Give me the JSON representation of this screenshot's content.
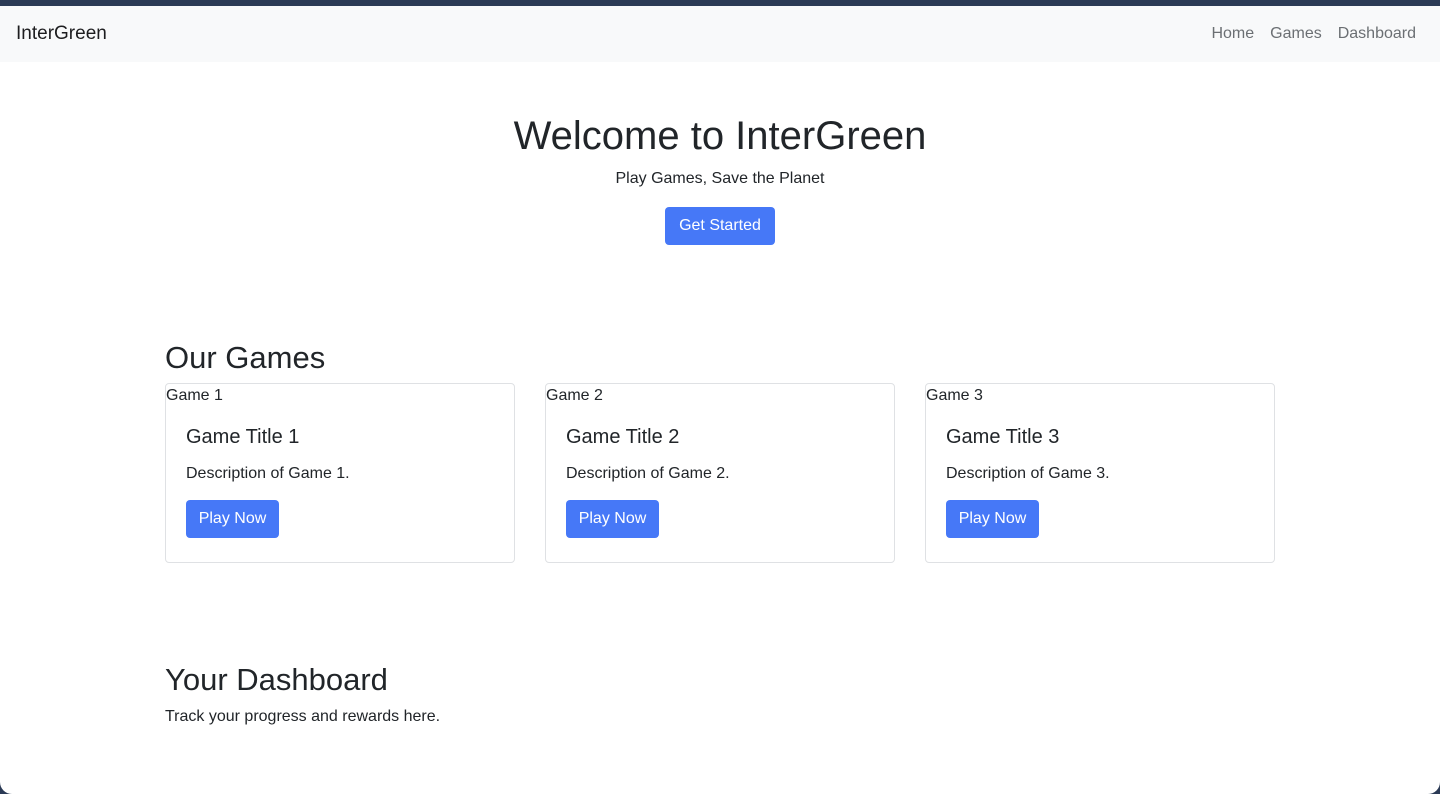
{
  "navbar": {
    "brand": "InterGreen",
    "links": [
      "Home",
      "Games",
      "Dashboard"
    ]
  },
  "hero": {
    "title": "Welcome to InterGreen",
    "subtitle": "Play Games, Save the Planet",
    "cta_label": "Get Started"
  },
  "games": {
    "heading": "Our Games",
    "cards": [
      {
        "img_alt": "Game 1",
        "title": "Game Title 1",
        "description": "Description of Game 1.",
        "button": "Play Now"
      },
      {
        "img_alt": "Game 2",
        "title": "Game Title 2",
        "description": "Description of Game 2.",
        "button": "Play Now"
      },
      {
        "img_alt": "Game 3",
        "title": "Game Title 3",
        "description": "Description of Game 3.",
        "button": "Play Now"
      }
    ]
  },
  "dashboard": {
    "heading": "Your Dashboard",
    "text": "Track your progress and rewards here."
  },
  "colors": {
    "primary": "#4678f7",
    "navbar_bg": "#f8f9fa",
    "text": "#212529",
    "nav_link": "#6b6f73"
  }
}
